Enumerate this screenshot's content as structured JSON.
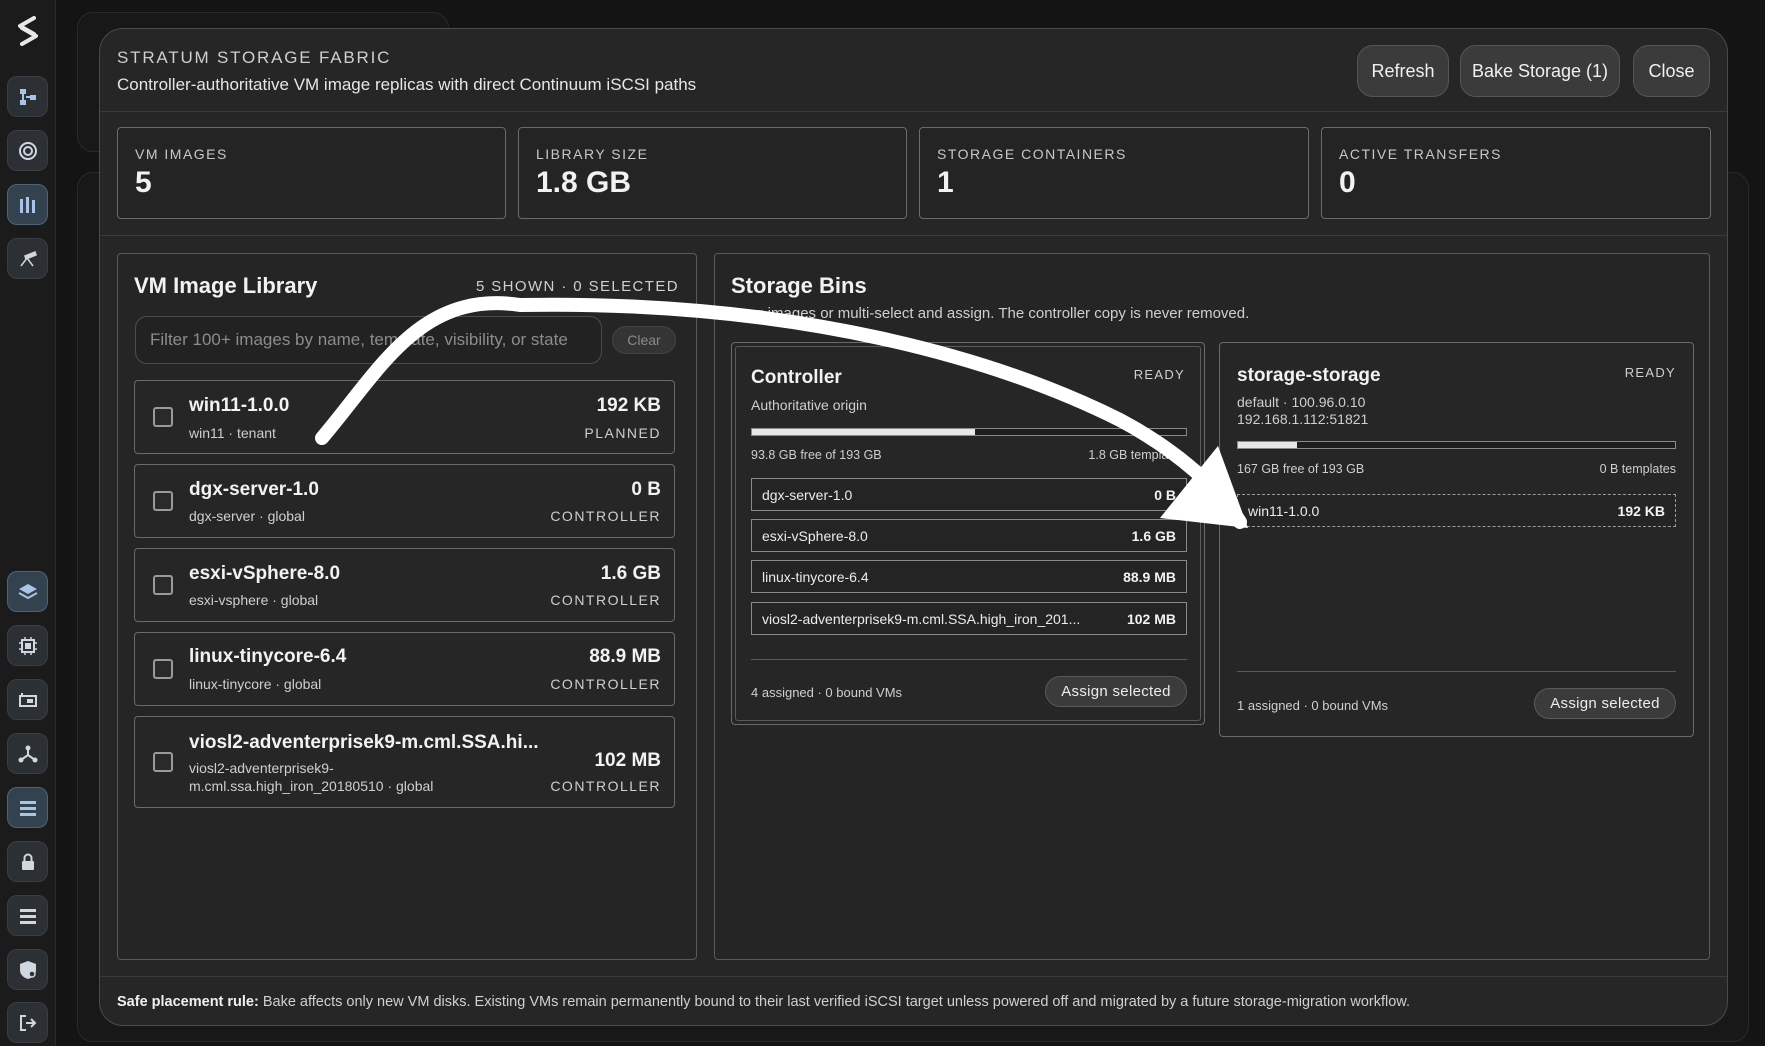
{
  "header": {
    "title": "STRATUM STORAGE FABRIC",
    "subtitle": "Controller-authoritative VM image replicas with direct Continuum iSCSI paths",
    "buttons": {
      "refresh": "Refresh",
      "bake": "Bake Storage (1)",
      "close": "Close"
    }
  },
  "stats": [
    {
      "label": "VM IMAGES",
      "value": "5"
    },
    {
      "label": "LIBRARY SIZE",
      "value": "1.8 GB"
    },
    {
      "label": "STORAGE CONTAINERS",
      "value": "1"
    },
    {
      "label": "ACTIVE TRANSFERS",
      "value": "0"
    }
  ],
  "library": {
    "title": "VM Image Library",
    "meta": "5 SHOWN · 0 SELECTED",
    "filter_placeholder": "Filter 100+ images by name, template, visibility, or state",
    "clear_label": "Clear",
    "items": [
      {
        "name": "win11-1.0.0",
        "sub": "win11 · tenant",
        "size": "192 KB",
        "state": "PLANNED"
      },
      {
        "name": "dgx-server-1.0",
        "sub": "dgx-server · global",
        "size": "0 B",
        "state": "CONTROLLER"
      },
      {
        "name": "esxi-vSphere-8.0",
        "sub": "esxi-vsphere · global",
        "size": "1.6 GB",
        "state": "CONTROLLER"
      },
      {
        "name": "linux-tinycore-6.4",
        "sub": "linux-tinycore · global",
        "size": "88.9 MB",
        "state": "CONTROLLER"
      },
      {
        "name": "viosl2-adventerprisek9-m.cml.SSA.hi...",
        "sub_line1": "viosl2-adventerprisek9-",
        "sub_line2": "m.cml.ssa.high_iron_20180510 · global",
        "size": "102 MB",
        "state": "CONTROLLER"
      }
    ]
  },
  "bins": {
    "title": "Storage Bins",
    "hint": "Drag images or multi-select and assign. The controller copy is never removed.",
    "controller": {
      "name": "Controller",
      "state": "READY",
      "sub": "Authoritative origin",
      "used_fraction": 0.514,
      "free": "93.8 GB free of 193 GB",
      "templates": "1.8 GB templates",
      "rows": [
        {
          "name": "dgx-server-1.0",
          "size": "0 B"
        },
        {
          "name": "esxi-vSphere-8.0",
          "size": "1.6 GB"
        },
        {
          "name": "linux-tinycore-6.4",
          "size": "88.9 MB"
        },
        {
          "name": "viosl2-adventerprisek9-m.cml.SSA.high_iron_201...",
          "size": "102 MB"
        }
      ],
      "footer": "4 assigned · 0 bound VMs",
      "assign_label": "Assign selected"
    },
    "storage": {
      "name": "storage-storage",
      "state": "READY",
      "sub_line1": "default · 100.96.0.10",
      "sub_line2": "192.168.1.112:51821",
      "used_fraction": 0.135,
      "free": "167 GB free of 193 GB",
      "templates": "0 B templates",
      "rows": [
        {
          "name": "win11-1.0.0",
          "size": "192 KB"
        }
      ],
      "footer": "1 assigned · 0 bound VMs",
      "assign_label": "Assign selected"
    }
  },
  "footer": {
    "rule_label": "Safe placement rule:",
    "rule_text": " Bake affects only new VM disks. Existing VMs remain permanently bound to their last verified iSCSI target unless powered off and migrated by a future storage-migration workflow."
  },
  "colors": {
    "modal_bg": "#262626",
    "rail_active": "#34414f",
    "accent_fill": "#e8e8e8"
  },
  "rail_icons": [
    "topology-icon",
    "target-icon",
    "storage-icon",
    "telescope-icon",
    "layers-icon",
    "chip-icon",
    "server-card-icon",
    "network-icon",
    "list-icon",
    "lock-icon",
    "rows-icon",
    "shield-icon",
    "logout-icon"
  ]
}
